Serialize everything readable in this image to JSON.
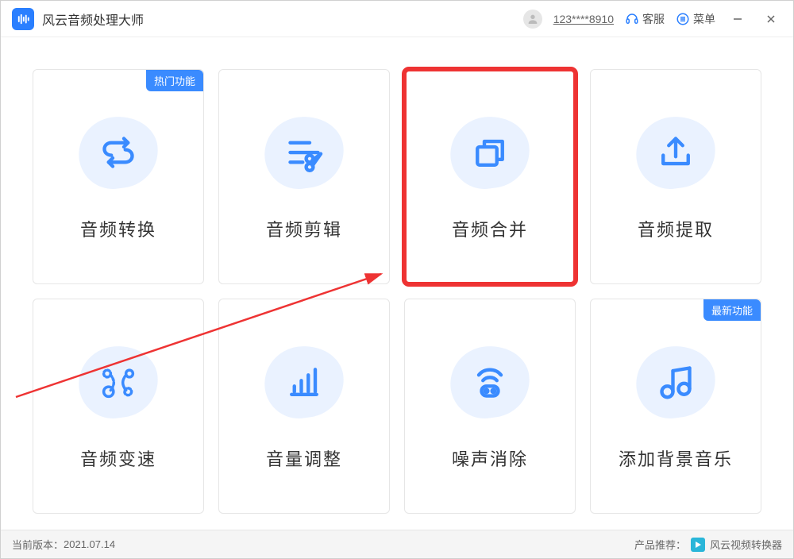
{
  "app": {
    "title": "风云音频处理大师"
  },
  "titlebar": {
    "user_phone": "123****8910",
    "support": "客服",
    "menu": "菜单"
  },
  "badges": {
    "hot": "热门功能",
    "new": "最新功能"
  },
  "cards": {
    "convert": "音频转换",
    "cut": "音频剪辑",
    "merge": "音频合并",
    "extract": "音频提取",
    "speed": "音频变速",
    "volume": "音量调整",
    "noise": "噪声消除",
    "bgm": "添加背景音乐"
  },
  "footer": {
    "version_label": "当前版本：",
    "version": "2021.07.14",
    "recommend_label": "产品推荐：",
    "recommend_product": "风云视频转换器"
  },
  "annotations": {
    "highlight_color": "#e33",
    "arrow_color": "#e33"
  }
}
